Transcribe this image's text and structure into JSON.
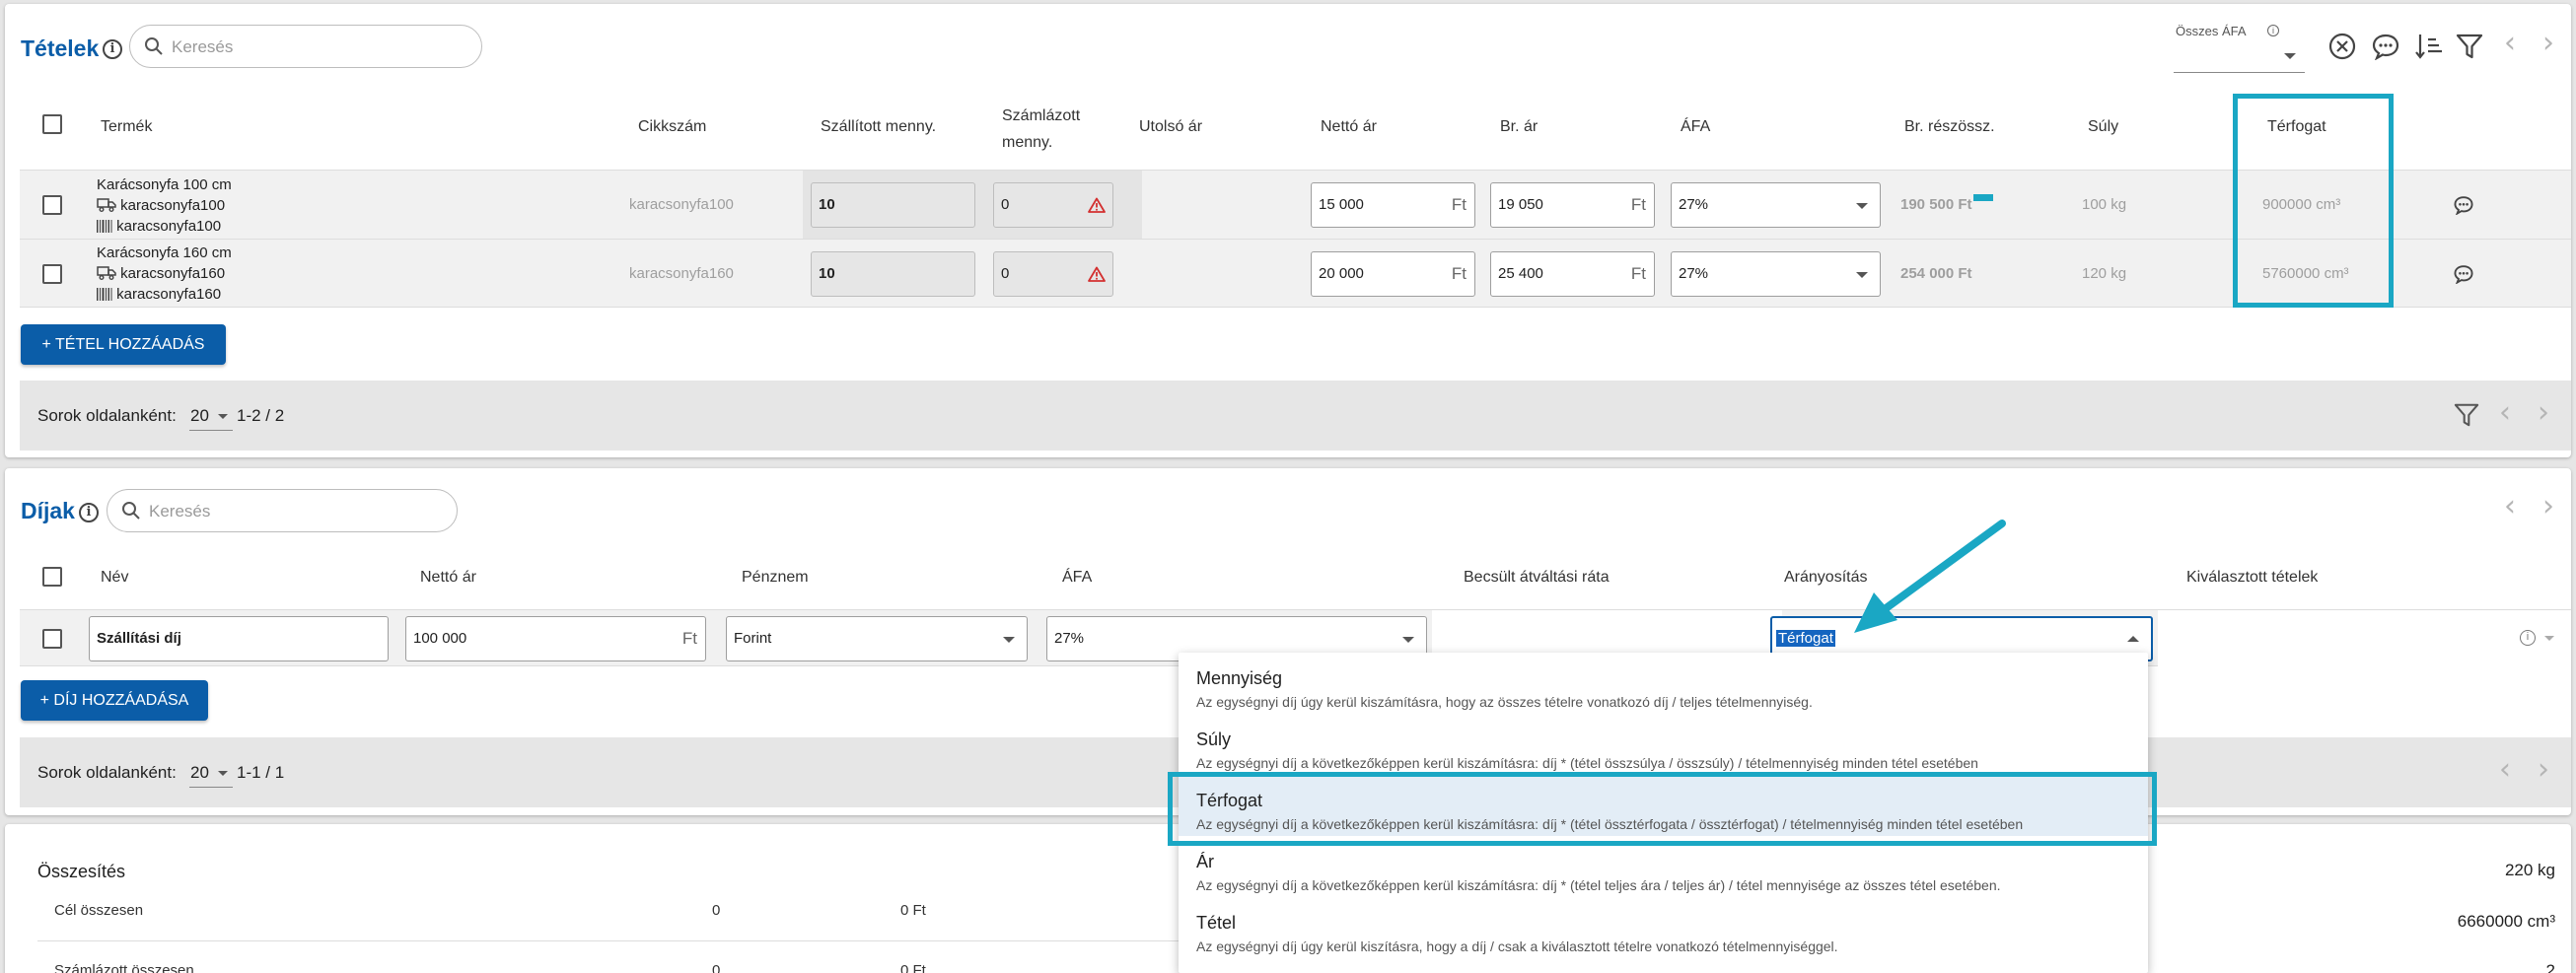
{
  "colors": {
    "accent": "#0b5da8",
    "highlight": "#1aa7c4",
    "warning": "#d32f2f"
  },
  "items": {
    "title": "Tételek",
    "search_placeholder": "Keresés",
    "afa_label": "Összes ÁFA",
    "headers": [
      "Termék",
      "Cikkszám",
      "Szállított menny.",
      "Számlázott",
      "menny.",
      "Utolsó ár",
      "Nettó ár",
      "Br. ár",
      "ÁFA",
      "Br. részössz.",
      "Súly",
      "Térfogat"
    ],
    "rows": [
      {
        "name": "Karácsonyfa 100 cm",
        "sub1": "karacsonyfa100",
        "sub2": "karacsonyfa100",
        "sku": "karacsonyfa100",
        "shipped": "10",
        "invoiced": "0",
        "net": "15 000",
        "gross": "19 050",
        "currency": "Ft",
        "vat": "27%",
        "subtotal": "190 500 Ft",
        "weight": "100 kg",
        "volume": "900000 cm³"
      },
      {
        "name": "Karácsonyfa 160 cm",
        "sub1": "karacsonyfa160",
        "sub2": "karacsonyfa160",
        "sku": "karacsonyfa160",
        "shipped": "10",
        "invoiced": "0",
        "net": "20 000",
        "gross": "25 400",
        "currency": "Ft",
        "vat": "27%",
        "subtotal": "254 000 Ft",
        "weight": "120 kg",
        "volume": "5760000 cm³"
      }
    ],
    "add_button": "+ TÉTEL HOZZÁADÁS",
    "per_page_label": "Sorok oldalanként:",
    "per_page": "20",
    "range": "1-2 / 2"
  },
  "fees": {
    "title": "Díjak",
    "search_placeholder": "Keresés",
    "headers": [
      "Név",
      "Nettó ár",
      "Pénznem",
      "ÁFA",
      "Becsült átváltási ráta",
      "Arányosítás",
      "Kiválasztott tételek"
    ],
    "row": {
      "name": "Szállítási díj",
      "net": "100 000",
      "currency_unit": "Ft",
      "currency": "Forint",
      "vat": "27%",
      "allocation": "Térfogat"
    },
    "add_button": "+ DÍJ HOZZÁADÁSA",
    "per_page_label": "Sorok oldalanként:",
    "per_page": "20",
    "range": "1-1 / 1"
  },
  "dropdown": {
    "options": [
      {
        "title": "Mennyiség",
        "desc": "Az egységnyi díj úgy kerül kiszámításra, hogy az összes tételre vonatkozó díj / teljes tételmennyiség."
      },
      {
        "title": "Súly",
        "desc": "Az egységnyi díj a következőképpen kerül kiszámításra: díj * (tétel összsúlya / összsúly) / tételmennyiség minden tétel esetében"
      },
      {
        "title": "Térfogat",
        "desc": "Az egységnyi díj a következőképpen kerül kiszámításra: díj * (tétel össztérfogata / össztérfogat) / tételmennyiség minden tétel esetében"
      },
      {
        "title": "Ár",
        "desc": "Az egységnyi díj a következőképpen kerül kiszámításra: díj * (tétel teljes ára / teljes ár) / tétel mennyisége az összes tétel esetében."
      },
      {
        "title": "Tétel",
        "desc": "Az egységnyi díj úgy kerül kiszításra, hogy a díj / csak a kiválasztott tételre vonatkozó tételmennyiséggel."
      }
    ]
  },
  "summary": {
    "title": "Összesítés",
    "rows": [
      {
        "label": "Cél összesen",
        "qty": "0",
        "amount": "0 Ft"
      },
      {
        "label": "Számlázott összesen",
        "qty": "0",
        "amount": "0 Ft"
      }
    ],
    "weight": "220 kg",
    "volume": "6660000 cm³",
    "count": "2"
  }
}
